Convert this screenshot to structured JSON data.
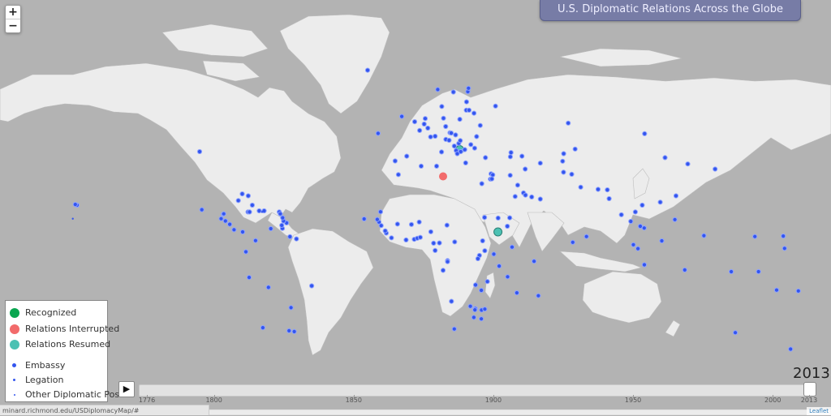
{
  "title": "U.S. Diplomatic Relations Across the Globe",
  "zoom": {
    "in_label": "+",
    "out_label": "−"
  },
  "legend": {
    "status_items": [
      {
        "label": "Recognized",
        "color": "#0aa650"
      },
      {
        "label": "Relations Interrupted",
        "color": "#f26b6b"
      },
      {
        "label": "Relations Resumed",
        "color": "#4cc1b3"
      }
    ],
    "post_items": [
      {
        "label": "Embassy",
        "color": "#3355ee"
      },
      {
        "label": "Legation",
        "color": "#3355ee"
      },
      {
        "label": "Other Diplomatic Post",
        "color": "#3355ee"
      }
    ]
  },
  "timeline": {
    "play_label": "▶",
    "current_year": "2013",
    "start_year": 1776,
    "end_year": 2013,
    "ticks": [
      "1776",
      "1800",
      "1850",
      "1900",
      "1950",
      "2000",
      "2013"
    ]
  },
  "status_url": "minard.richmond.edu/USDiplomacyMap/#",
  "attribution": "Leaflet",
  "colors": {
    "ocean": "#b3b3b3",
    "land": "#ececec",
    "border": "#bdbdbd",
    "embassy": "#3355ee"
  },
  "map_markers": {
    "embassies": [
      [
        -100,
        42
      ],
      [
        -99,
        19
      ],
      [
        -90,
        15
      ],
      [
        -88,
        14
      ],
      [
        -86,
        12.5
      ],
      [
        -84,
        10
      ],
      [
        -80,
        9
      ],
      [
        -77.5,
        18
      ],
      [
        -74,
        5
      ],
      [
        -78.5,
        -0.2
      ],
      [
        -77,
        -12
      ],
      [
        -68,
        -16.5
      ],
      [
        -57.5,
        -25.3
      ],
      [
        -56,
        -34.9
      ],
      [
        -58.4,
        -34.6
      ],
      [
        -47.9,
        -15.8
      ],
      [
        -66.9,
        10.5
      ],
      [
        -58,
        6.8
      ],
      [
        -55,
        5.8
      ],
      [
        -61.5,
        10.6
      ],
      [
        -59.6,
        13.1
      ],
      [
        -61.8,
        12
      ],
      [
        -72.3,
        18.5
      ],
      [
        -70,
        18.5
      ],
      [
        -76.8,
        18
      ],
      [
        -77.4,
        25
      ],
      [
        -75.5,
        21
      ],
      [
        -82,
        23
      ],
      [
        -63,
        18
      ],
      [
        -61,
        14
      ],
      [
        -62.5,
        17.2
      ],
      [
        -61.4,
        15.4
      ],
      [
        -70.6,
        -33.4
      ],
      [
        -89,
        17
      ],
      [
        -88.8,
        17.2
      ],
      [
        -157,
        21
      ],
      [
        -21.9,
        64.1
      ],
      [
        -6,
        53
      ],
      [
        0,
        51.5
      ],
      [
        2.3,
        48.9
      ],
      [
        4.4,
        50.8
      ],
      [
        4.9,
        52.4
      ],
      [
        6.1,
        49.6
      ],
      [
        7.4,
        46.9
      ],
      [
        9.5,
        47.1
      ],
      [
        12.5,
        41.9
      ],
      [
        13.4,
        52.5
      ],
      [
        14.4,
        50.1
      ],
      [
        16.4,
        48.2
      ],
      [
        19,
        47.5
      ],
      [
        17,
        48.1
      ],
      [
        21,
        52.2
      ],
      [
        24,
        54.7
      ],
      [
        24.1,
        56.9
      ],
      [
        24.7,
        59.4
      ],
      [
        25,
        60.2
      ],
      [
        18,
        59.3
      ],
      [
        10.7,
        59.9
      ],
      [
        12.6,
        55.7
      ],
      [
        -3.7,
        40.4
      ],
      [
        -9.1,
        38.7
      ],
      [
        14.5,
        46.1
      ],
      [
        16,
        45.8
      ],
      [
        18.4,
        43.9
      ],
      [
        20.5,
        44.8
      ],
      [
        19.3,
        42.4
      ],
      [
        21.4,
        42
      ],
      [
        19.8,
        41.3
      ],
      [
        23.3,
        42.7
      ],
      [
        26.1,
        44.4
      ],
      [
        28.8,
        47
      ],
      [
        30.5,
        50.4
      ],
      [
        27.6,
        53.9
      ],
      [
        37.6,
        55.8
      ],
      [
        23.7,
        38
      ],
      [
        35.5,
        33.9
      ],
      [
        36.3,
        33.5
      ],
      [
        35.2,
        31.8
      ],
      [
        35.9,
        31.9
      ],
      [
        32.9,
        39.9
      ],
      [
        44.5,
        40.2
      ],
      [
        44.8,
        41.7
      ],
      [
        49.9,
        40.4
      ],
      [
        51.4,
        35.7
      ],
      [
        44.4,
        33.3
      ],
      [
        47.9,
        29.4
      ],
      [
        50.6,
        26.2
      ],
      [
        51.5,
        25.3
      ],
      [
        54.4,
        24.5
      ],
      [
        58.4,
        23.6
      ],
      [
        46.7,
        24.7
      ],
      [
        44.2,
        15.4
      ],
      [
        69.2,
        34.5
      ],
      [
        73,
        33.7
      ],
      [
        77.2,
        28.6
      ],
      [
        85.3,
        27.7
      ],
      [
        90.4,
        23.8
      ],
      [
        89.6,
        27.5
      ],
      [
        79.9,
        6.9
      ],
      [
        73.5,
        4.2
      ],
      [
        69.3,
        41.3
      ],
      [
        71.4,
        51.1
      ],
      [
        74.6,
        42.9
      ],
      [
        68.8,
        38.6
      ],
      [
        58.4,
        37.9
      ],
      [
        106.9,
        47.9
      ],
      [
        116.4,
        39.9
      ],
      [
        127,
        37.6
      ],
      [
        139.7,
        35.7
      ],
      [
        121.5,
        25
      ],
      [
        114.2,
        22.3
      ],
      [
        96.1,
        16.8
      ],
      [
        100.5,
        13.8
      ],
      [
        102.6,
        18
      ],
      [
        105.8,
        21
      ],
      [
        106.7,
        10.8
      ],
      [
        104.9,
        11.6
      ],
      [
        101.7,
        3.1
      ],
      [
        103.8,
        1.3
      ],
      [
        106.8,
        -6.2
      ],
      [
        114.9,
        4.9
      ],
      [
        121,
        14.6
      ],
      [
        125.6,
        -8.6
      ],
      [
        147.2,
        -9.4
      ],
      [
        159.9,
        -9.4
      ],
      [
        168.3,
        -17.7
      ],
      [
        178.4,
        -18.1
      ],
      [
        172,
        1.4
      ],
      [
        171.4,
        7.1
      ],
      [
        158.2,
        6.9
      ],
      [
        134.5,
        7.3
      ],
      [
        149.1,
        -35.3
      ],
      [
        174.8,
        -41.3
      ],
      [
        -10.8,
        6.3
      ],
      [
        -13.2,
        8.5
      ],
      [
        -13.7,
        9.5
      ],
      [
        -15.6,
        11.9
      ],
      [
        -16.6,
        13.5
      ],
      [
        -17.4,
        14.7
      ],
      [
        -23.5,
        14.9
      ],
      [
        -8,
        12.6
      ],
      [
        -1.5,
        12.4
      ],
      [
        2.1,
        13.5
      ],
      [
        -4,
        5.3
      ],
      [
        -0.2,
        5.6
      ],
      [
        1.2,
        6.1
      ],
      [
        2.6,
        6.5
      ],
      [
        7.5,
        9.1
      ],
      [
        9.5,
        0.4
      ],
      [
        8.8,
        3.8
      ],
      [
        11.5,
        3.9
      ],
      [
        18.6,
        4.4
      ],
      [
        15.3,
        -4.3
      ],
      [
        15.3,
        -4.8
      ],
      [
        13.2,
        -8.8
      ],
      [
        17.1,
        -22.6
      ],
      [
        25.9,
        -24.7
      ],
      [
        28.2,
        -25.7
      ],
      [
        31.1,
        -26.3
      ],
      [
        27.5,
        -29.3
      ],
      [
        32.6,
        -25.9
      ],
      [
        28.3,
        -15.4
      ],
      [
        31,
        -17.8
      ],
      [
        33.8,
        -13.9
      ],
      [
        39.3,
        -6.8
      ],
      [
        30.1,
        -1.9
      ],
      [
        29.4,
        -3.4
      ],
      [
        32.6,
        0.3
      ],
      [
        36.8,
        -1.3
      ],
      [
        45.3,
        2
      ],
      [
        43.1,
        11.6
      ],
      [
        38.8,
        15.3
      ],
      [
        32.5,
        15.6
      ],
      [
        31.6,
        4.9
      ],
      [
        15,
        12.1
      ],
      [
        -15.9,
        18.1
      ],
      [
        -7.6,
        33.6
      ],
      [
        3,
        36.8
      ],
      [
        10.2,
        36.8
      ],
      [
        31.2,
        30
      ],
      [
        47.5,
        -18.9
      ],
      [
        57.5,
        -20.2
      ],
      [
        55.5,
        -4.6
      ],
      [
        43.2,
        -11.7
      ],
      [
        25.3,
        54.7
      ],
      [
        27.9,
        43.2
      ],
      [
        21.2,
        45.7
      ],
      [
        31,
        -29.9
      ],
      [
        28,
        -26.2
      ],
      [
        18.4,
        -33.9
      ],
      [
        -80.2,
        25.8
      ],
      [
        -17,
        48
      ],
      [
        -157.8,
        21.3
      ]
    ],
    "legations": [
      [
        -159,
        15
      ],
      [
        -71,
        18
      ]
    ],
    "interrupted": [
      [
        13.2,
        32.9
      ]
    ],
    "resumed": [
      [
        38.7,
        9
      ],
      [
        20.9,
        42.7
      ]
    ]
  }
}
